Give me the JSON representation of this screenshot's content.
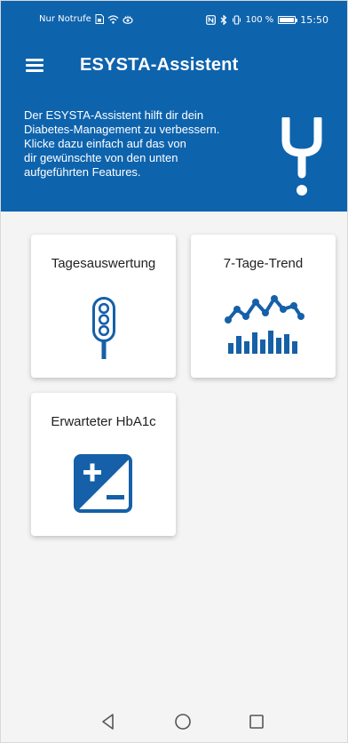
{
  "status_bar": {
    "carrier": "Nur Notrufe",
    "battery": "100 %",
    "battery_level": 1.0,
    "time": "15:50"
  },
  "app_bar": {
    "title": "ESYSTA-Assistent",
    "menu_icon": "hamburger-menu-icon"
  },
  "banner": {
    "lines": [
      "Der ESYSTA-Assistent hilft dir dein",
      "Diabetes-Management zu verbessern.",
      "Klicke dazu einfach auf das von",
      "dir gewünschte von den unten",
      "aufgeführten Features."
    ],
    "logo_icon": "esysta-logo-icon"
  },
  "features": [
    {
      "label": "Tagesauswertung",
      "icon": "traffic-light-icon"
    },
    {
      "label": "7-Tage-Trend",
      "icon": "trend-chart-icon"
    },
    {
      "label": "Erwarteter HbA1c",
      "icon": "plus-minus-icon"
    }
  ],
  "colors": {
    "primary": "#0e63ad",
    "background": "#f4f4f4",
    "card": "#ffffff",
    "icon": "#1560a8"
  },
  "navigation_bar": [
    "back-icon",
    "home-icon",
    "recents-icon"
  ]
}
